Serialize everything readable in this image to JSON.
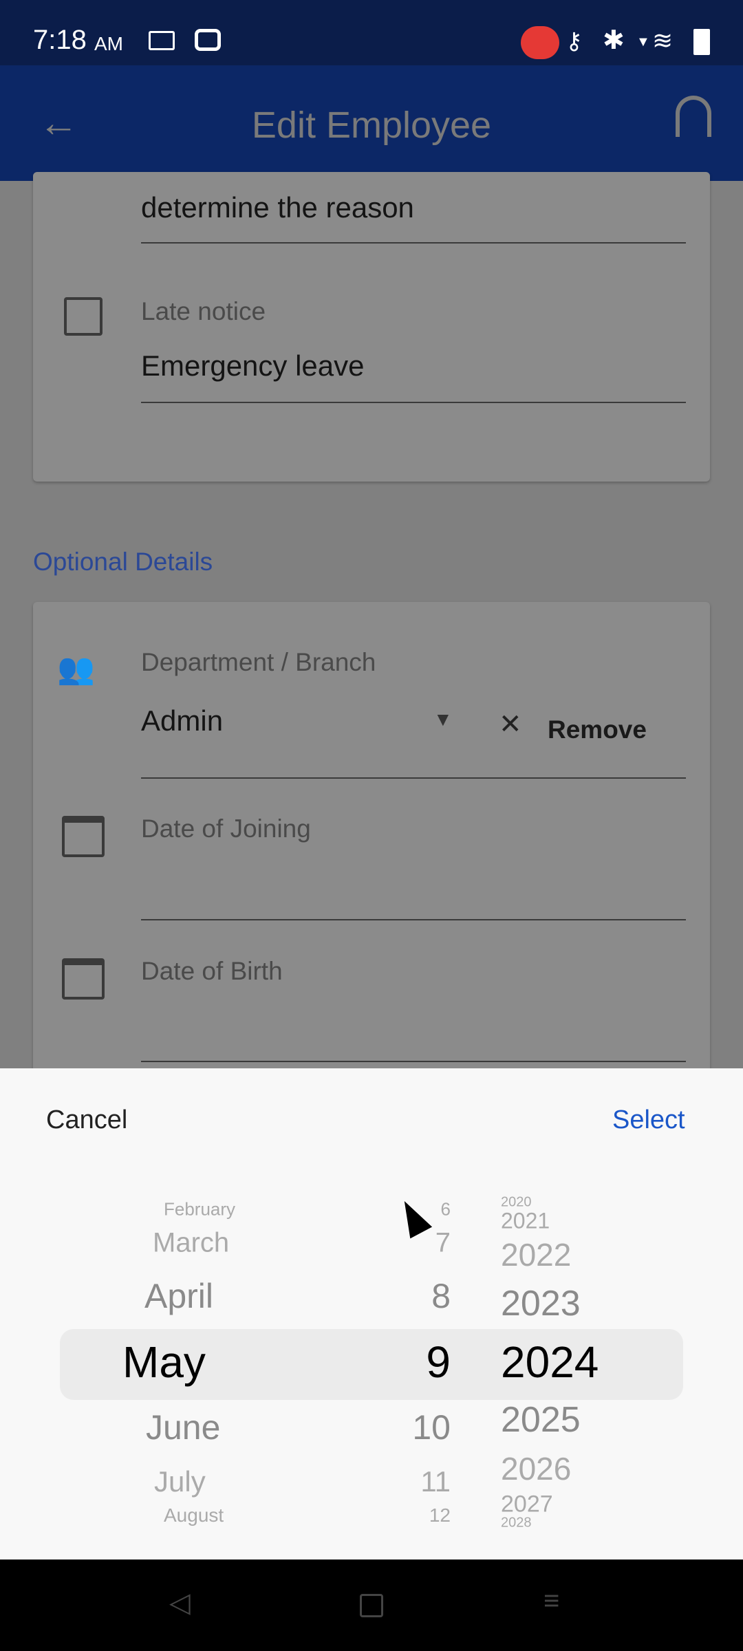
{
  "status_bar": {
    "time": "7:18",
    "ampm": "AM",
    "icons": [
      "screen-record-icon",
      "sync-icon",
      "recording-badge-icon",
      "vpn-key-icon",
      "bluetooth-icon",
      "wifi-icon",
      "battery-icon"
    ],
    "record_badge_color": "#e53935"
  },
  "app_bar": {
    "title": "Edit Employee",
    "back_icon": "arrow-left-icon",
    "support_icon": "headset-icon"
  },
  "form": {
    "prev_field_value": "determine the reason",
    "late_notice": {
      "label": "Late notice",
      "value": "Emergency leave"
    },
    "optional_section_title": "Optional Details",
    "department": {
      "label": "Department / Branch",
      "value": "Admin",
      "remove_label": "Remove"
    },
    "date_of_joining": {
      "label": "Date of Joining",
      "value": ""
    },
    "date_of_birth": {
      "label": "Date of Birth",
      "value": ""
    }
  },
  "date_picker": {
    "cancel_label": "Cancel",
    "select_label": "Select",
    "months": [
      "February",
      "March",
      "April",
      "May",
      "June",
      "July",
      "August"
    ],
    "days": [
      "6",
      "7",
      "8",
      "9",
      "10",
      "11",
      "12"
    ],
    "years": [
      "2020",
      "2021",
      "2022",
      "2023",
      "2024",
      "2025",
      "2026",
      "2027",
      "2028"
    ],
    "selected": {
      "month": "May",
      "day": "9",
      "year": "2024"
    },
    "accent_color": "#1a56c8"
  }
}
